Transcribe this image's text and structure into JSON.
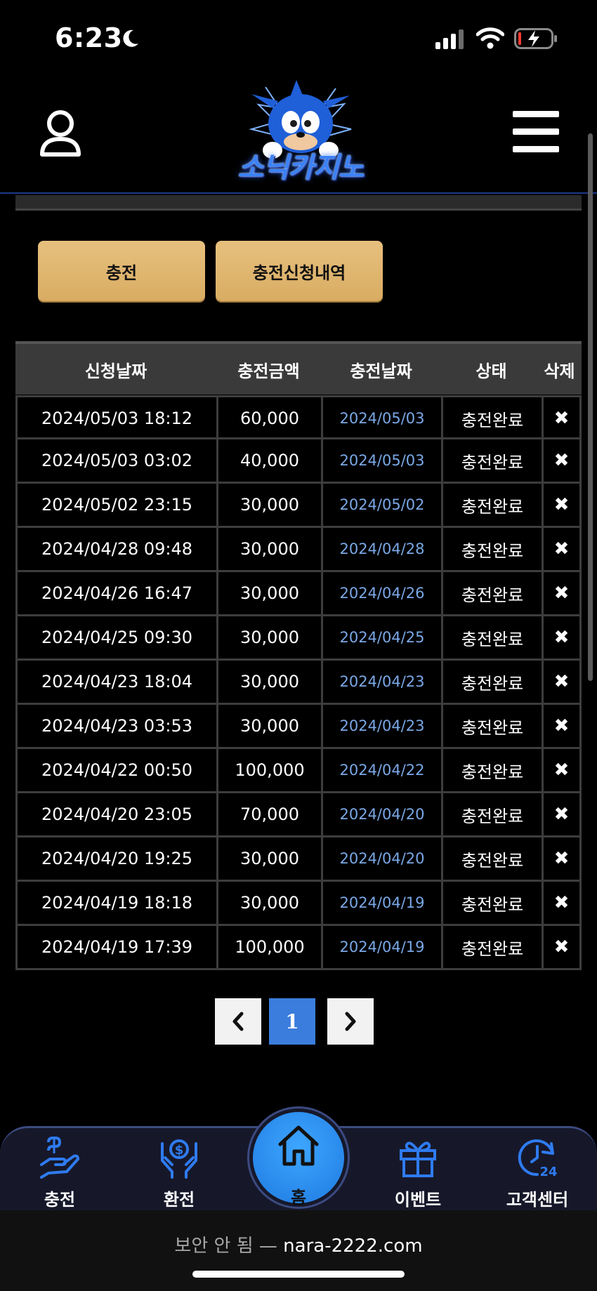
{
  "status_bar": {
    "time": "6:23"
  },
  "header": {
    "logo_text": "소닉카지노"
  },
  "tabs": {
    "charge": "충전",
    "history": "충전신청내역"
  },
  "table": {
    "columns": [
      "신청날짜",
      "충전금액",
      "충전날짜",
      "상태",
      "삭제"
    ],
    "rows": [
      {
        "request_date": "2024/05/03 18:12",
        "amount": "60,000",
        "charge_date": "2024/05/03",
        "status": "충전완료"
      },
      {
        "request_date": "2024/05/03 03:02",
        "amount": "40,000",
        "charge_date": "2024/05/03",
        "status": "충전완료"
      },
      {
        "request_date": "2024/05/02 23:15",
        "amount": "30,000",
        "charge_date": "2024/05/02",
        "status": "충전완료"
      },
      {
        "request_date": "2024/04/28 09:48",
        "amount": "30,000",
        "charge_date": "2024/04/28",
        "status": "충전완료"
      },
      {
        "request_date": "2024/04/26 16:47",
        "amount": "30,000",
        "charge_date": "2024/04/26",
        "status": "충전완료"
      },
      {
        "request_date": "2024/04/25 09:30",
        "amount": "30,000",
        "charge_date": "2024/04/25",
        "status": "충전완료"
      },
      {
        "request_date": "2024/04/23 18:04",
        "amount": "30,000",
        "charge_date": "2024/04/23",
        "status": "충전완료"
      },
      {
        "request_date": "2024/04/23 03:53",
        "amount": "30,000",
        "charge_date": "2024/04/23",
        "status": "충전완료"
      },
      {
        "request_date": "2024/04/22 00:50",
        "amount": "100,000",
        "charge_date": "2024/04/22",
        "status": "충전완료"
      },
      {
        "request_date": "2024/04/20 23:05",
        "amount": "70,000",
        "charge_date": "2024/04/20",
        "status": "충전완료"
      },
      {
        "request_date": "2024/04/20 19:25",
        "amount": "30,000",
        "charge_date": "2024/04/20",
        "status": "충전완료"
      },
      {
        "request_date": "2024/04/19 18:18",
        "amount": "30,000",
        "charge_date": "2024/04/19",
        "status": "충전완료"
      },
      {
        "request_date": "2024/04/19 17:39",
        "amount": "100,000",
        "charge_date": "2024/04/19",
        "status": "충전완료"
      }
    ],
    "delete_glyph": "✖"
  },
  "pagination": {
    "prev": "‹",
    "current": "1",
    "next": "›"
  },
  "bottom_nav": {
    "charge": "충전",
    "exchange": "환전",
    "home": "홈",
    "event": "이벤트",
    "support": "고객센터"
  },
  "browser": {
    "prefix": "보안 안 됨 — ",
    "domain": "nara-2222.com"
  },
  "colors": {
    "accent_gold": "#e1b56e",
    "accent_blue": "#3b7ddd",
    "date_link": "#7aa8e6"
  },
  "icons": [
    "moon-icon",
    "signal-icon",
    "wifi-icon",
    "battery-charging-icon",
    "user-icon",
    "menu-icon",
    "close-icon",
    "chevron-left-icon",
    "chevron-right-icon",
    "hand-coin-icon",
    "hands-money-icon",
    "home-icon",
    "gift-icon",
    "clock-24-icon"
  ]
}
